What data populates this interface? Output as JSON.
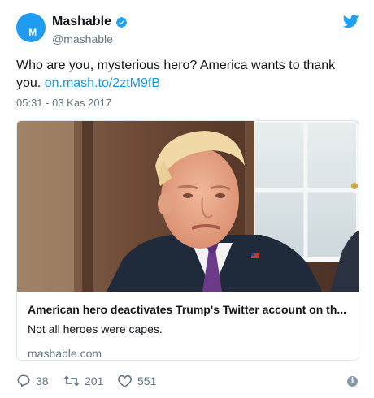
{
  "author": {
    "display_name": "Mashable",
    "handle": "@mashable",
    "avatar_letter": "M",
    "verified": true
  },
  "tweet": {
    "text": "Who are you, mysterious hero? America wants to thank you.",
    "link": "on.mash.to/2ztM9fB",
    "timestamp": "05:31 - 03 Kas 2017"
  },
  "card": {
    "title": "American hero deactivates Trump's Twitter account on th...",
    "description": "Not all heroes were capes.",
    "domain": "mashable.com"
  },
  "actions": {
    "replies": "38",
    "retweets": "201",
    "likes": "551"
  },
  "colors": {
    "brand_blue": "#1da1f2",
    "link_blue": "#1b95e0",
    "muted": "#657786",
    "border": "#e1e8ed"
  },
  "icons": [
    "twitter-bird-icon",
    "verified-badge-icon",
    "reply-icon",
    "retweet-icon",
    "like-icon",
    "info-icon"
  ]
}
